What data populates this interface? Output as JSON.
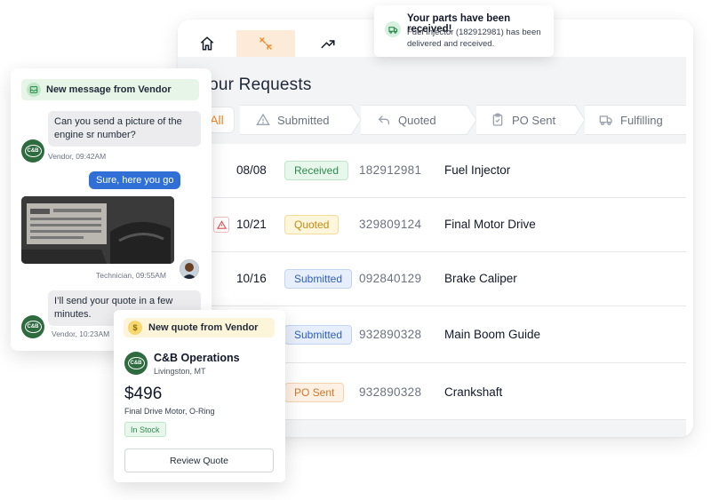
{
  "nav": {
    "items": [
      {
        "name": "home",
        "icon": "home-icon"
      },
      {
        "name": "requests",
        "icon": "wrench-icon",
        "active": true
      },
      {
        "name": "analytics",
        "icon": "trend-icon"
      }
    ],
    "active_color": "#fdebd9"
  },
  "page": {
    "title": "Your Requests"
  },
  "filters": [
    {
      "label": "All",
      "icon": ""
    },
    {
      "label": "Submitted",
      "icon": "warning-triangle-icon"
    },
    {
      "label": "Quoted",
      "icon": "reply-arrow-icon"
    },
    {
      "label": "PO Sent",
      "icon": "clipboard-icon"
    },
    {
      "label": "Fulfilling",
      "icon": "truck-icon"
    }
  ],
  "requests": [
    {
      "date": "08/08",
      "status": "Received",
      "status_key": "received",
      "number": "182912981",
      "part": "Fuel Injector",
      "alert": false
    },
    {
      "date": "10/21",
      "status": "Quoted",
      "status_key": "quoted",
      "number": "329809124",
      "part": "Final Motor Drive",
      "alert": true
    },
    {
      "date": "10/16",
      "status": "Submitted",
      "status_key": "submitted",
      "number": "092840129",
      "part": "Brake Caliper",
      "alert": false
    },
    {
      "date": "",
      "status": "Submitted",
      "status_key": "submitted",
      "number": "932890328",
      "part": "Main Boom Guide",
      "alert": false
    },
    {
      "date": "",
      "status": "PO Sent",
      "status_key": "posent",
      "number": "932890328",
      "part": "Crankshaft",
      "alert": false
    }
  ],
  "toast": {
    "title": "Your parts have been received!",
    "body": "Fuel Injector (182912981) has been delivered and received.",
    "icon": "truck-icon"
  },
  "chat": {
    "header": "New message from Vendor",
    "vendor_logo": "C&B",
    "messages": [
      {
        "text": "Can you send a picture of the engine sr number?",
        "meta": "Vendor, 09:42AM"
      },
      {
        "text": "Sure, here you go"
      },
      {
        "meta": "Technician, 09:55AM"
      },
      {
        "text": "I’ll send your quote in a few minutes.",
        "meta": "Vendor, 10:23AM"
      }
    ]
  },
  "quote": {
    "header": "New quote from Vendor",
    "vendor_logo": "C&B",
    "vendor_name": "C&B Operations",
    "location": "Livingston, MT",
    "price": "$496",
    "description": "Final Drive Motor, O-Ring",
    "stock": "In Stock",
    "button": "Review Quote"
  },
  "colors": {
    "accent": "#f08a2a",
    "received": "#2e8b4f",
    "quoted": "#c08a12",
    "submitted": "#2f5fb8",
    "posent": "#d4762a",
    "chat_out": "#2f6fd6"
  }
}
